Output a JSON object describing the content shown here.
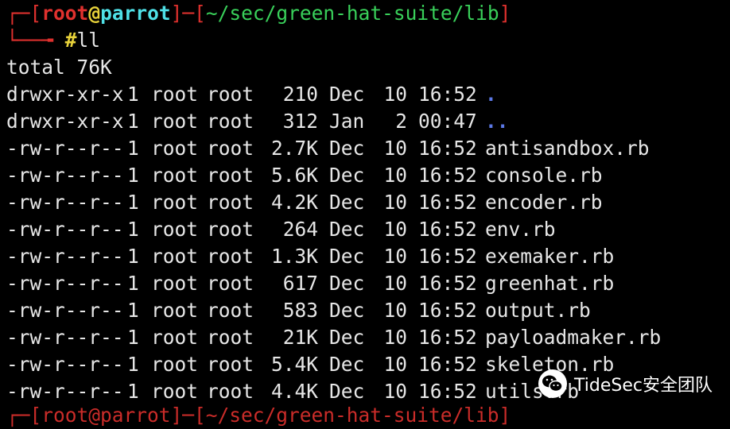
{
  "colors": {
    "prompt_bracket": "#e0312e",
    "user": "#e0312e",
    "host": "#4fe0e6",
    "path": "#39d05a",
    "command_hash": "#e8d23a",
    "dir_name": "#5b78e6",
    "text": "#e6e6e6",
    "background": "#000000"
  },
  "prompt": {
    "corner_top": "┌─",
    "bracket_open": "[",
    "user": "root",
    "at": "@",
    "host": "parrot",
    "bracket_close": "]",
    "dash": "─",
    "path_open": "[",
    "path": "~/sec/green-hat-suite/lib",
    "path_close": "]",
    "corner_bottom": "└──╼",
    "hash": "#",
    "command": "ll"
  },
  "total": "total 76K",
  "listing": [
    {
      "perm": "drwxr-xr-x",
      "links": "1",
      "owner": "root",
      "group": "root",
      "size": "210",
      "month": "Dec",
      "day": "10",
      "time": "16:52",
      "name": ".",
      "is_dir": true
    },
    {
      "perm": "drwxr-xr-x",
      "links": "1",
      "owner": "root",
      "group": "root",
      "size": "312",
      "month": "Jan",
      "day": "2",
      "time": "00:47",
      "name": "..",
      "is_dir": true
    },
    {
      "perm": "-rw-r--r--",
      "links": "1",
      "owner": "root",
      "group": "root",
      "size": "2.7K",
      "month": "Dec",
      "day": "10",
      "time": "16:52",
      "name": "antisandbox.rb",
      "is_dir": false
    },
    {
      "perm": "-rw-r--r--",
      "links": "1",
      "owner": "root",
      "group": "root",
      "size": "5.6K",
      "month": "Dec",
      "day": "10",
      "time": "16:52",
      "name": "console.rb",
      "is_dir": false
    },
    {
      "perm": "-rw-r--r--",
      "links": "1",
      "owner": "root",
      "group": "root",
      "size": "4.2K",
      "month": "Dec",
      "day": "10",
      "time": "16:52",
      "name": "encoder.rb",
      "is_dir": false
    },
    {
      "perm": "-rw-r--r--",
      "links": "1",
      "owner": "root",
      "group": "root",
      "size": "264",
      "month": "Dec",
      "day": "10",
      "time": "16:52",
      "name": "env.rb",
      "is_dir": false
    },
    {
      "perm": "-rw-r--r--",
      "links": "1",
      "owner": "root",
      "group": "root",
      "size": "1.3K",
      "month": "Dec",
      "day": "10",
      "time": "16:52",
      "name": "exemaker.rb",
      "is_dir": false
    },
    {
      "perm": "-rw-r--r--",
      "links": "1",
      "owner": "root",
      "group": "root",
      "size": "617",
      "month": "Dec",
      "day": "10",
      "time": "16:52",
      "name": "greenhat.rb",
      "is_dir": false
    },
    {
      "perm": "-rw-r--r--",
      "links": "1",
      "owner": "root",
      "group": "root",
      "size": "583",
      "month": "Dec",
      "day": "10",
      "time": "16:52",
      "name": "output.rb",
      "is_dir": false
    },
    {
      "perm": "-rw-r--r--",
      "links": "1",
      "owner": "root",
      "group": "root",
      "size": "21K",
      "month": "Dec",
      "day": "10",
      "time": "16:52",
      "name": "payloadmaker.rb",
      "is_dir": false
    },
    {
      "perm": "-rw-r--r--",
      "links": "1",
      "owner": "root",
      "group": "root",
      "size": "5.4K",
      "month": "Dec",
      "day": "10",
      "time": "16:52",
      "name": "skeleton.rb",
      "is_dir": false
    },
    {
      "perm": "-rw-r--r--",
      "links": "1",
      "owner": "root",
      "group": "root",
      "size": "4.4K",
      "month": "Dec",
      "day": "10",
      "time": "16:52",
      "name": "utils.rb",
      "is_dir": false
    }
  ],
  "next_prompt_partial": "┌─[root@parrot]─[~/sec/green-hat-suite/lib]",
  "watermark": {
    "icon": "wechat-icon",
    "text": "TideSec安全团队"
  }
}
